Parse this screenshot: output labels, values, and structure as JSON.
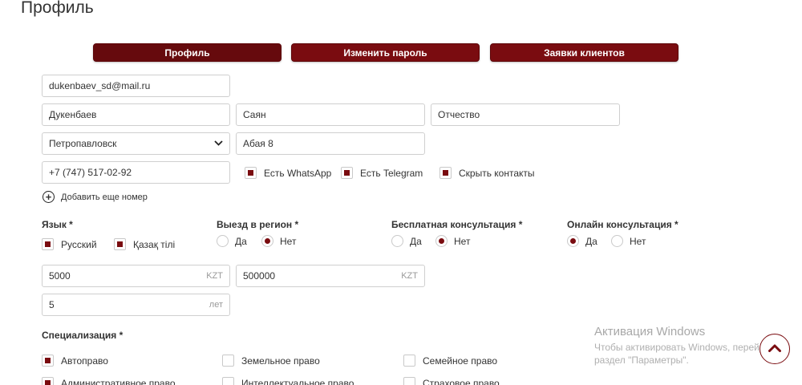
{
  "page_title": "Профиль",
  "tabs": [
    {
      "label": "Профиль"
    },
    {
      "label": "Изменить пароль"
    },
    {
      "label": "Заявки клиентов"
    }
  ],
  "form": {
    "email": "dukenbaev_sd@mail.ru",
    "last_name": "Дукенбаев",
    "first_name": "Саян",
    "middle_name_placeholder": "Отчество",
    "city": "Петропавловск",
    "address": "Абая 8",
    "phone": "+7 (747) 517-02-92",
    "whatsapp_label": "Есть WhatsApp",
    "telegram_label": "Есть Telegram",
    "hide_contacts_label": "Скрыть контакты",
    "add_phone_label": "Добавить еще номер",
    "price1": "5000",
    "price1_suffix": "KZT",
    "price2": "500000",
    "price2_suffix": "KZT",
    "experience": "5",
    "experience_suffix": "лет"
  },
  "checks": {
    "whatsapp": true,
    "telegram": true,
    "hide_contacts": true
  },
  "language": {
    "label": "Язык *",
    "options": [
      {
        "label": "Русский",
        "checked": true
      },
      {
        "label": "Қазақ тілі",
        "checked": true
      }
    ]
  },
  "region_trip": {
    "label": "Выезд в регион *",
    "yes": "Да",
    "no": "Нет",
    "selected": "no"
  },
  "free_consult": {
    "label": "Бесплатная консультация *",
    "yes": "Да",
    "no": "Нет",
    "selected": "no"
  },
  "online_consult": {
    "label": "Онлайн консультация *",
    "yes": "Да",
    "no": "Нет",
    "selected": "yes"
  },
  "specialization": {
    "label": "Специализация *",
    "items": [
      {
        "label": "Автоправо",
        "checked": true
      },
      {
        "label": "Земельное право",
        "checked": false
      },
      {
        "label": "Семейное право",
        "checked": false
      },
      {
        "label": "Административное право",
        "checked": true
      },
      {
        "label": "Интеллектуальное право",
        "checked": false
      },
      {
        "label": "Страховое право",
        "checked": false
      }
    ]
  },
  "windows_activation": {
    "title": "Активация Windows",
    "text": "Чтобы активировать Windows, перейдите в раздел \"Параметры\"."
  },
  "colors": {
    "accent": "#7a0c10",
    "border": "#cfcfcf"
  },
  "icons": {
    "scroll_top": "chevron-up-icon",
    "add": "plus-circle-icon",
    "dropdown": "chevron-down-icon"
  }
}
